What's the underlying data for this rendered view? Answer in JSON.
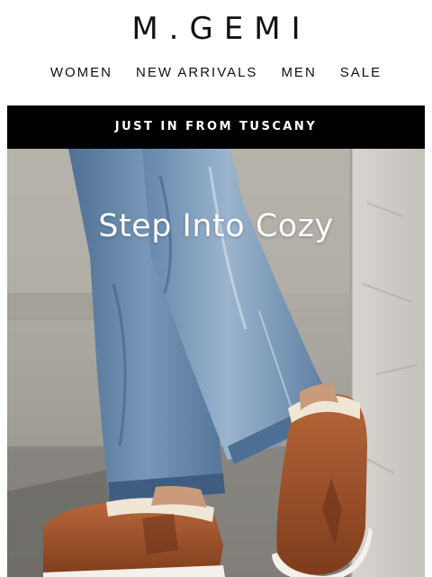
{
  "brand": {
    "logo_text": "M.GEMI"
  },
  "nav": {
    "items": [
      {
        "label": "WOMEN"
      },
      {
        "label": "NEW ARRIVALS"
      },
      {
        "label": "MEN"
      },
      {
        "label": "SALE"
      }
    ]
  },
  "banner": {
    "text": "JUST IN FROM TUSCANY"
  },
  "hero": {
    "title": "Step Into Cozy",
    "image_subject": "Cognac leather shearling-lined slip-on shoes worn with light-wash denim jeans on a cobblestone street",
    "colors": {
      "denim": "#6f8fb0",
      "leather": "#a0552a",
      "shearling": "#efe6d6",
      "stone": "#bdbab3"
    }
  }
}
